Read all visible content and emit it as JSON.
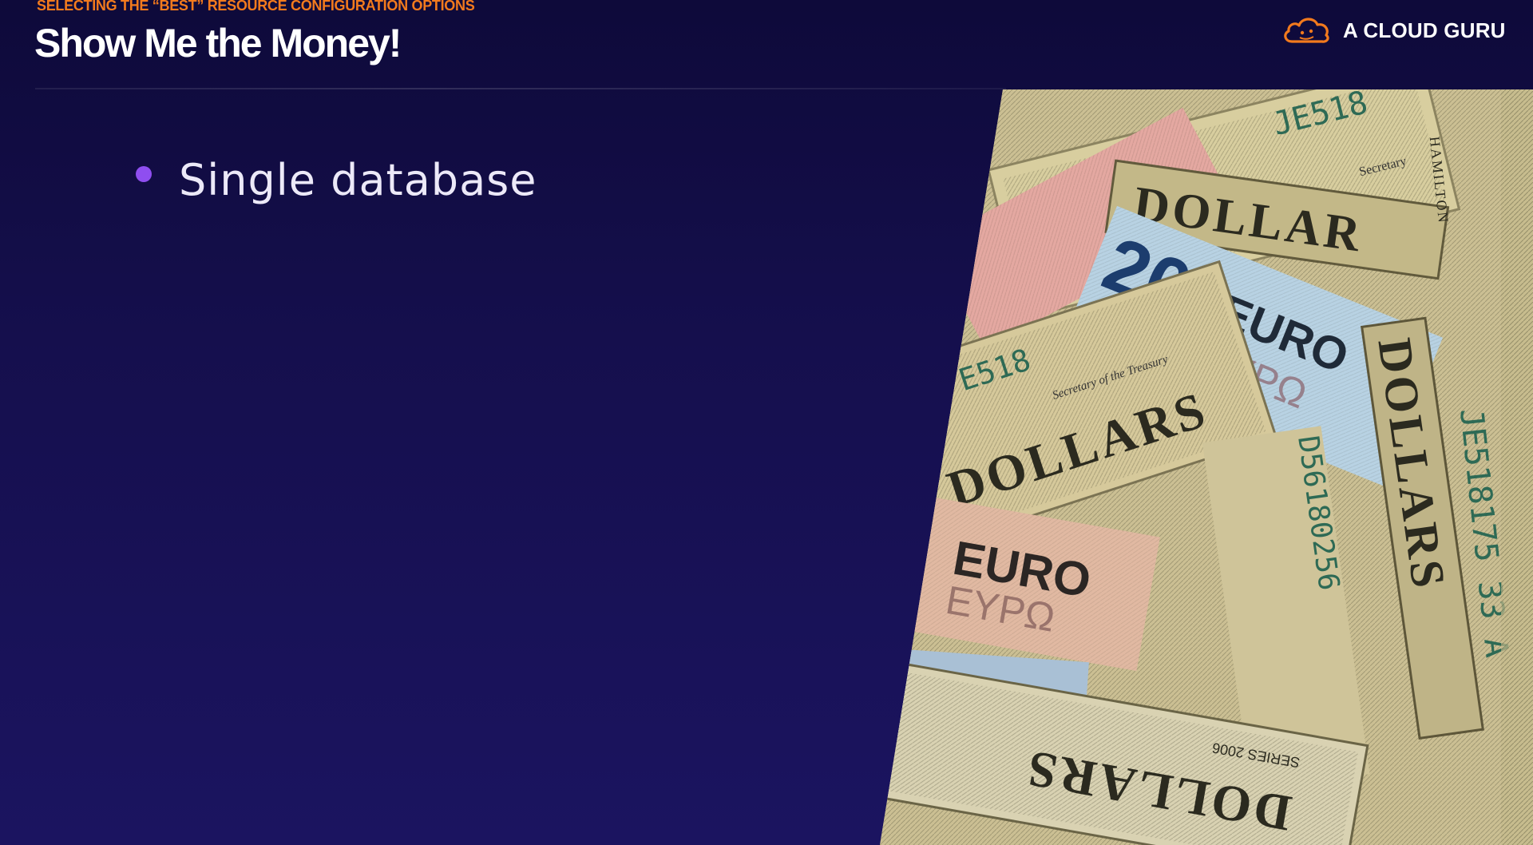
{
  "header": {
    "section_label": "SELECTING THE “BEST” RESOURCE CONFIGURATION OPTIONS",
    "title": "Show Me the Money!"
  },
  "brand": {
    "name": "A CLOUD GURU",
    "icon": "cloud-icon",
    "accent_color": "#f27a1d"
  },
  "content": {
    "bullets": [
      {
        "text": "Single database"
      }
    ],
    "bullet_color": "#8f4ef0"
  },
  "photo": {
    "subject": "banknotes-photo",
    "texts": {
      "serial_top": "JE518",
      "dollars_1": "DOLLAR",
      "euro_20_value": "20",
      "euro_20_label": "EURO",
      "euro_20_greek": "ΕΥΡΩ",
      "serial_mid": "E518",
      "dollars_2": "DOLLARS",
      "euro_label_2": "EURO",
      "euro_greek_2": "ΕΥΡΩ",
      "serial_vertical_1": "D56180256",
      "dollars_vertical": "DOLLARS",
      "serial_vertical_2": "JE518175 33 A",
      "euro_flipped": "EURO",
      "dollars_flipped": "DOLLARS",
      "series": "SERIES 2006",
      "treasury": "Secretary of the Treasury",
      "secretary": "Secretary",
      "hamilton": "HAMILTON"
    }
  },
  "colors": {
    "background_top": "#0e0a3a",
    "background_bottom": "#1b1460",
    "title": "#ffffff",
    "section_label": "#f27a1d"
  }
}
